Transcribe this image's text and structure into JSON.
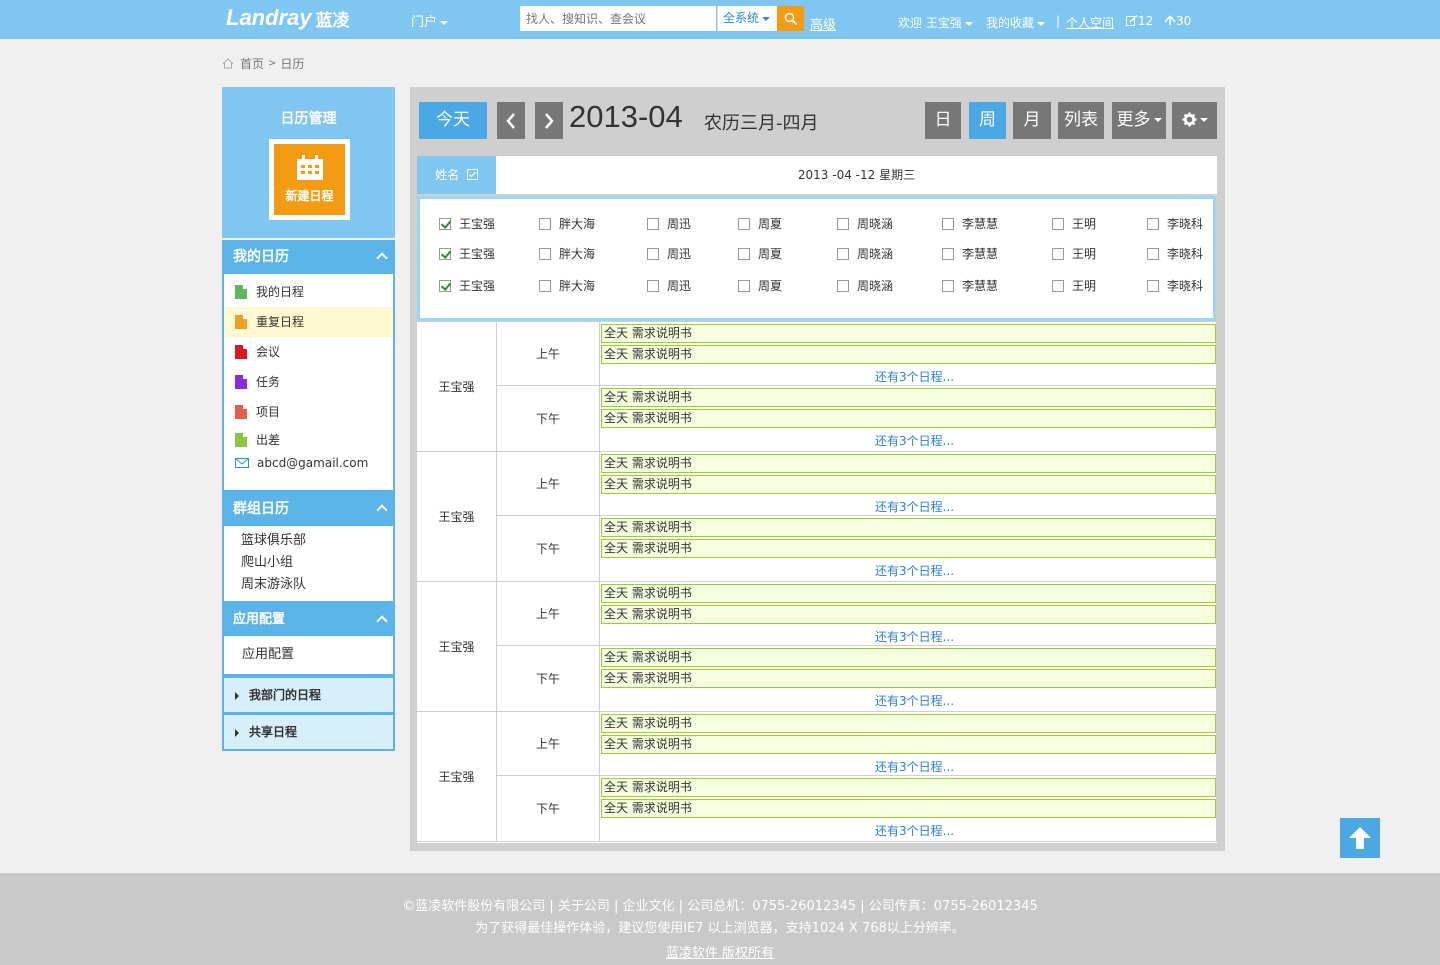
{
  "header": {
    "logo_en": "Landray",
    "logo_cn": "蓝凌",
    "portal": "门户",
    "search_placeholder": "找人、搜知识、查会议",
    "search_scope": "全系统",
    "advanced": "高级",
    "welcome": "欢迎 王宝强",
    "favorites": "我的收藏",
    "separator": "|",
    "personal_space": "个人空间",
    "edit_count": "12",
    "up_count": "30"
  },
  "breadcrumb": {
    "home": "首页",
    "sep": ">",
    "current": "日历"
  },
  "sidebar": {
    "title": "日历管理",
    "new_button": "新建日程",
    "my_calendar": {
      "title": "我的日历",
      "items": [
        {
          "label": "我的日程",
          "color": "#5cb85c"
        },
        {
          "label": "重复日程",
          "color": "#f0a020"
        },
        {
          "label": "会议",
          "color": "#d9181e"
        },
        {
          "label": "任务",
          "color": "#8a2be2"
        },
        {
          "label": "项目",
          "color": "#e8604c"
        },
        {
          "label": "出差",
          "color": "#8cc63f"
        }
      ],
      "email": "abcd@gamail.com"
    },
    "group_calendar": {
      "title": "群组日历",
      "items": [
        "篮球俱乐部",
        "爬山小组",
        "周末游泳队"
      ]
    },
    "app_config": {
      "title": "应用配置",
      "item": "应用配置"
    },
    "dept_schedule": "我部门的日程",
    "shared_schedule": "共享日程"
  },
  "toolbar": {
    "today": "今天",
    "month": "2013-04",
    "lunar": "农历三月-四月",
    "views": [
      "日",
      "周",
      "月",
      "列表"
    ],
    "active_view": "周",
    "more": "更多"
  },
  "table": {
    "name_header": "姓名",
    "date_header": "2013 -04 -12 星期三"
  },
  "picker": {
    "names": [
      "王宝强",
      "胖大海",
      "周迅",
      "周夏",
      "周晓涵",
      "李慧慧",
      "王明",
      "李晓科"
    ],
    "checked_first": true
  },
  "schedule": {
    "rows": [
      {
        "name": "王宝强"
      },
      {
        "name": "王宝强"
      },
      {
        "name": "王宝强"
      },
      {
        "name": "王宝强"
      }
    ],
    "am": "上午",
    "pm": "下午",
    "event": "全天 需求说明书",
    "more": "还有3个日程..."
  },
  "footer": {
    "line1": "©蓝凌软件股份有限公司 | 关于公司 | 企业文化  |  公司总机：0755-26012345 | 公司传真：0755-26012345",
    "line2": "为了获得最佳操作体验，建议您使用IE7 以上浏览器，支持1024 X 768以上分辨率。",
    "line3": "蓝凌软件 版权所有"
  },
  "colors": {
    "topbar": "#7fc6f0",
    "accent": "#4aa8e4",
    "orange": "#f39c12",
    "event_border": "#9acd32"
  }
}
